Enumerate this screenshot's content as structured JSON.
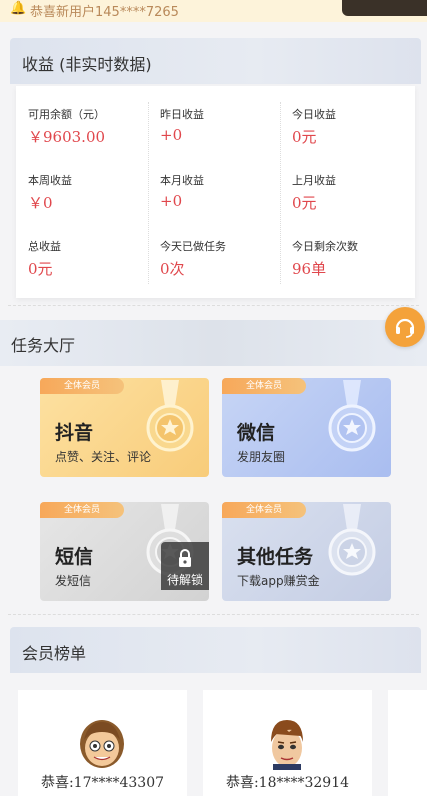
{
  "marquee": {
    "text": "恭喜新用户145****7265",
    "icon": "bell-icon"
  },
  "earnings": {
    "title": "收益 (非实时数据)",
    "stats": [
      {
        "label": "可用余额（元）",
        "value": "￥9603.00"
      },
      {
        "label": "昨日收益",
        "value": "+0"
      },
      {
        "label": "今日收益",
        "value": "0元"
      },
      {
        "label": "本周收益",
        "value": "￥0"
      },
      {
        "label": "本月收益",
        "value": "+0"
      },
      {
        "label": "上月收益",
        "value": "0元"
      },
      {
        "label": "总收益",
        "value": "0元"
      },
      {
        "label": "今天已做任务",
        "value": "0次"
      },
      {
        "label": "今日剩余次数",
        "value": "96单"
      }
    ]
  },
  "task_hall": {
    "title": "任务大厅",
    "tasks": [
      {
        "badge": "全体会员",
        "name": "抖音",
        "sub": "点赞、关注、评论",
        "locked": false,
        "bg": "#fbd48a",
        "medal": "gold"
      },
      {
        "badge": "全体会员",
        "name": "微信",
        "sub": "发朋友圈",
        "locked": false,
        "bg": "#b8c8f0",
        "medal": "blue"
      },
      {
        "badge": "全体会员",
        "name": "短信",
        "sub": "发短信",
        "locked": true,
        "lock_text": "待解锁",
        "bg": "#dcdcdc",
        "medal": "silver"
      },
      {
        "badge": "全体会员",
        "name": "其他任务",
        "sub": "下载app赚赏金",
        "locked": false,
        "bg": "#cfd7ea",
        "medal": "silver"
      }
    ]
  },
  "members": {
    "title": "会员榜单",
    "list": [
      {
        "name": "恭喜:17****43307",
        "avatar": "avatar-boy-icon"
      },
      {
        "name": "恭喜:18****32914",
        "avatar": "avatar-man-icon"
      }
    ]
  },
  "colors": {
    "accent_red": "#e0474c",
    "service_orange": "#f4a23a",
    "badge_orange": "#f7a85a"
  }
}
